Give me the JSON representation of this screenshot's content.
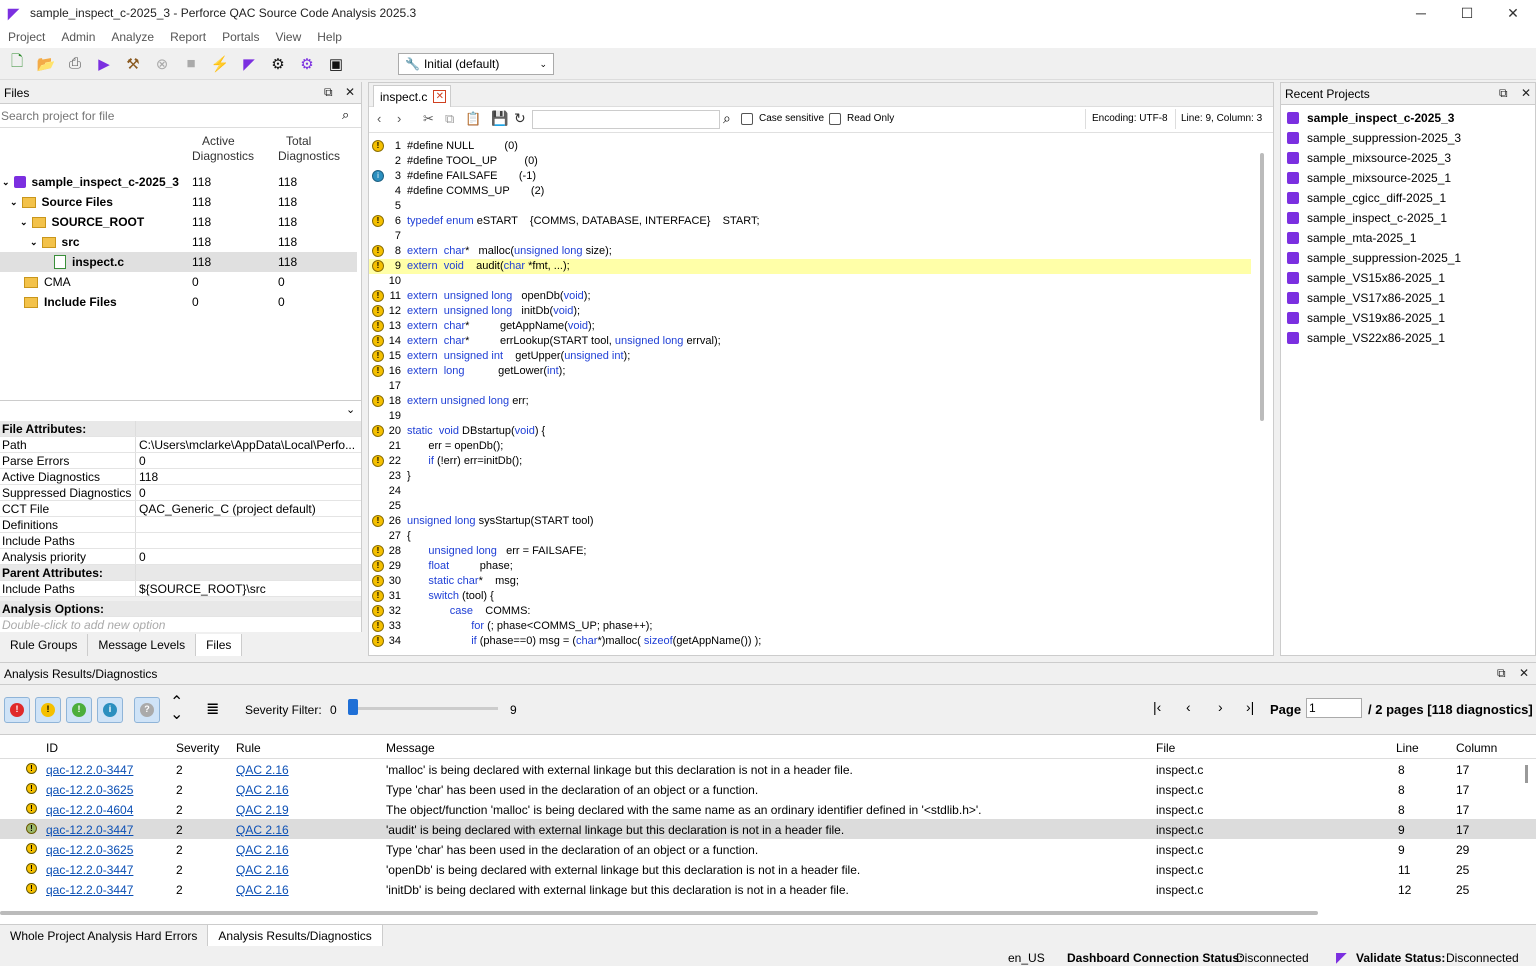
{
  "window": {
    "title": "sample_inspect_c-2025_3 - Perforce QAC Source Code Analysis 2025.3",
    "minimize": "─",
    "maximize": "☐",
    "close": "✕"
  },
  "menu": [
    "Project",
    "Admin",
    "Analyze",
    "Report",
    "Portals",
    "View",
    "Help"
  ],
  "toolbar": {
    "config": "Initial (default)"
  },
  "files": {
    "title": "Files",
    "search_placeholder": "Search project for file",
    "col_active": "Active",
    "col_active2": "Diagnostics",
    "col_total": "Total",
    "col_total2": "Diagnostics",
    "rows": [
      {
        "label": "sample_inspect_c-2025_3",
        "active": "118",
        "total": "118"
      },
      {
        "label": "Source Files",
        "active": "118",
        "total": "118"
      },
      {
        "label": "SOURCE_ROOT",
        "active": "118",
        "total": "118"
      },
      {
        "label": "src",
        "active": "118",
        "total": "118"
      },
      {
        "label": "inspect.c",
        "active": "118",
        "total": "118"
      },
      {
        "label": "CMA",
        "active": "0",
        "total": "0"
      },
      {
        "label": "Include Files",
        "active": "0",
        "total": "0"
      }
    ]
  },
  "attributes": {
    "file_header": "File Attributes:",
    "rows": [
      {
        "k": "Path",
        "v": "C:\\Users\\mclarke\\AppData\\Local\\Perfo..."
      },
      {
        "k": "Parse Errors",
        "v": "0"
      },
      {
        "k": "Active Diagnostics",
        "v": "118"
      },
      {
        "k": "Suppressed Diagnostics",
        "v": "0"
      },
      {
        "k": "CCT File",
        "v": "QAC_Generic_C (project default)"
      },
      {
        "k": "Definitions",
        "v": ""
      },
      {
        "k": "Include Paths",
        "v": ""
      },
      {
        "k": "Analysis priority",
        "v": "0"
      }
    ],
    "parent_header": "Parent Attributes:",
    "parent_rows": [
      {
        "k": "Include Paths",
        "v": "${SOURCE_ROOT}\\src"
      }
    ],
    "options_header": "Analysis Options:",
    "options_placeholder": "Double-click to add new option"
  },
  "left_tabs": [
    "Rule Groups",
    "Message Levels",
    "Files"
  ],
  "editor": {
    "tab": "inspect.c",
    "case_sensitive": "Case sensitive",
    "read_only": "Read Only",
    "encoding": "Encoding: UTF-8",
    "position": "Line: 9, Column: 3",
    "lines": [
      {
        "n": "1",
        "m": "w",
        "t": "#define NULL          (0)"
      },
      {
        "n": "2",
        "m": "",
        "t": "#define TOOL_UP         (0)"
      },
      {
        "n": "3",
        "m": "i",
        "t": "#define FAILSAFE       (-1)"
      },
      {
        "n": "4",
        "m": "",
        "t": "#define COMMS_UP       (2)"
      },
      {
        "n": "5",
        "m": "",
        "t": ""
      },
      {
        "n": "6",
        "m": "w",
        "t": "typedef enum eSTART    {COMMS, DATABASE, INTERFACE}    START;"
      },
      {
        "n": "7",
        "m": "",
        "t": ""
      },
      {
        "n": "8",
        "m": "w",
        "t": "extern  char*   malloc(unsigned long size);"
      },
      {
        "n": "9",
        "m": "w",
        "t": "extern  void    audit(char *fmt, ...);"
      },
      {
        "n": "10",
        "m": "",
        "t": ""
      },
      {
        "n": "11",
        "m": "w",
        "t": "extern  unsigned long   openDb(void);"
      },
      {
        "n": "12",
        "m": "w",
        "t": "extern  unsigned long   initDb(void);"
      },
      {
        "n": "13",
        "m": "w",
        "t": "extern  char*          getAppName(void);"
      },
      {
        "n": "14",
        "m": "w",
        "t": "extern  char*          errLookup(START tool, unsigned long errval);"
      },
      {
        "n": "15",
        "m": "w",
        "t": "extern  unsigned int    getUpper(unsigned int);"
      },
      {
        "n": "16",
        "m": "w",
        "t": "extern  long           getLower(int);"
      },
      {
        "n": "17",
        "m": "",
        "t": ""
      },
      {
        "n": "18",
        "m": "w",
        "t": "extern unsigned long err;"
      },
      {
        "n": "19",
        "m": "",
        "t": ""
      },
      {
        "n": "20",
        "m": "w",
        "t": "static  void DBstartup(void) {"
      },
      {
        "n": "21",
        "m": "",
        "t": "       err = openDb();"
      },
      {
        "n": "22",
        "m": "w",
        "t": "       if (!err) err=initDb();"
      },
      {
        "n": "23",
        "m": "",
        "t": "}"
      },
      {
        "n": "24",
        "m": "",
        "t": ""
      },
      {
        "n": "25",
        "m": "",
        "t": ""
      },
      {
        "n": "26",
        "m": "w",
        "t": "unsigned long sysStartup(START tool)"
      },
      {
        "n": "27",
        "m": "",
        "t": "{"
      },
      {
        "n": "28",
        "m": "w",
        "t": "       unsigned long   err = FAILSAFE;"
      },
      {
        "n": "29",
        "m": "w",
        "t": "       float          phase;"
      },
      {
        "n": "30",
        "m": "w",
        "t": "       static char*    msg;"
      },
      {
        "n": "31",
        "m": "w",
        "t": "       switch (tool) {"
      },
      {
        "n": "32",
        "m": "w",
        "t": "              case    COMMS:"
      },
      {
        "n": "33",
        "m": "w",
        "t": "                     for (; phase<COMMS_UP; phase++);"
      },
      {
        "n": "34",
        "m": "w",
        "t": "                     if (phase==0) msg = (char*)malloc( sizeof(getAppName()) );"
      }
    ]
  },
  "recent": {
    "title": "Recent Projects",
    "items": [
      "sample_inspect_c-2025_3",
      "sample_suppression-2025_3",
      "sample_mixsource-2025_3",
      "sample_mixsource-2025_1",
      "sample_cgicc_diff-2025_1",
      "sample_inspect_c-2025_1",
      "sample_mta-2025_1",
      "sample_suppression-2025_1",
      "sample_VS15x86-2025_1",
      "sample_VS17x86-2025_1",
      "sample_VS19x86-2025_1",
      "sample_VS22x86-2025_1"
    ]
  },
  "results": {
    "title": "Analysis Results/Diagnostics",
    "severity_label": "Severity Filter:",
    "sev_min": "0",
    "sev_max": "9",
    "page_label": "Page",
    "page_value": "1",
    "pages_text": "/ 2 pages [118 diagnostics]",
    "headers": [
      "ID",
      "Severity",
      "Rule",
      "Message",
      "File",
      "Line",
      "Column"
    ],
    "rows": [
      {
        "id": "qac-12.2.0-3447",
        "sev": "2",
        "rule": "QAC 2.16",
        "msg": "'malloc' is being declared with external linkage but this declaration is not in a header file.",
        "file": "inspect.c",
        "line": "8",
        "col": "17"
      },
      {
        "id": "qac-12.2.0-3625",
        "sev": "2",
        "rule": "QAC 2.16",
        "msg": "Type 'char' has been used in the declaration of an object or a function.",
        "file": "inspect.c",
        "line": "8",
        "col": "17"
      },
      {
        "id": "qac-12.2.0-4604",
        "sev": "2",
        "rule": "QAC 2.19",
        "msg": "The object/function 'malloc' is being declared with the same name as an ordinary identifier defined in '<stdlib.h>'.",
        "file": "inspect.c",
        "line": "8",
        "col": "17"
      },
      {
        "id": "qac-12.2.0-3447",
        "sev": "2",
        "rule": "QAC 2.16",
        "msg": "'audit' is being declared with external linkage but this declaration is not in a header file.",
        "file": "inspect.c",
        "line": "9",
        "col": "17"
      },
      {
        "id": "qac-12.2.0-3625",
        "sev": "2",
        "rule": "QAC 2.16",
        "msg": "Type 'char' has been used in the declaration of an object or a function.",
        "file": "inspect.c",
        "line": "9",
        "col": "29"
      },
      {
        "id": "qac-12.2.0-3447",
        "sev": "2",
        "rule": "QAC 2.16",
        "msg": "'openDb' is being declared with external linkage but this declaration is not in a header file.",
        "file": "inspect.c",
        "line": "11",
        "col": "25"
      },
      {
        "id": "qac-12.2.0-3447",
        "sev": "2",
        "rule": "QAC 2.16",
        "msg": "'initDb' is being declared with external linkage but this declaration is not in a header file.",
        "file": "inspect.c",
        "line": "12",
        "col": "25"
      }
    ]
  },
  "bottom_tabs": [
    "Whole Project Analysis Hard Errors",
    "Analysis Results/Diagnostics"
  ],
  "status": {
    "locale": "en_US",
    "dash_label": "Dashboard Connection Status:",
    "dash_value": "Disconnected",
    "validate_label": "Validate Status:",
    "validate_value": "Disconnected"
  }
}
